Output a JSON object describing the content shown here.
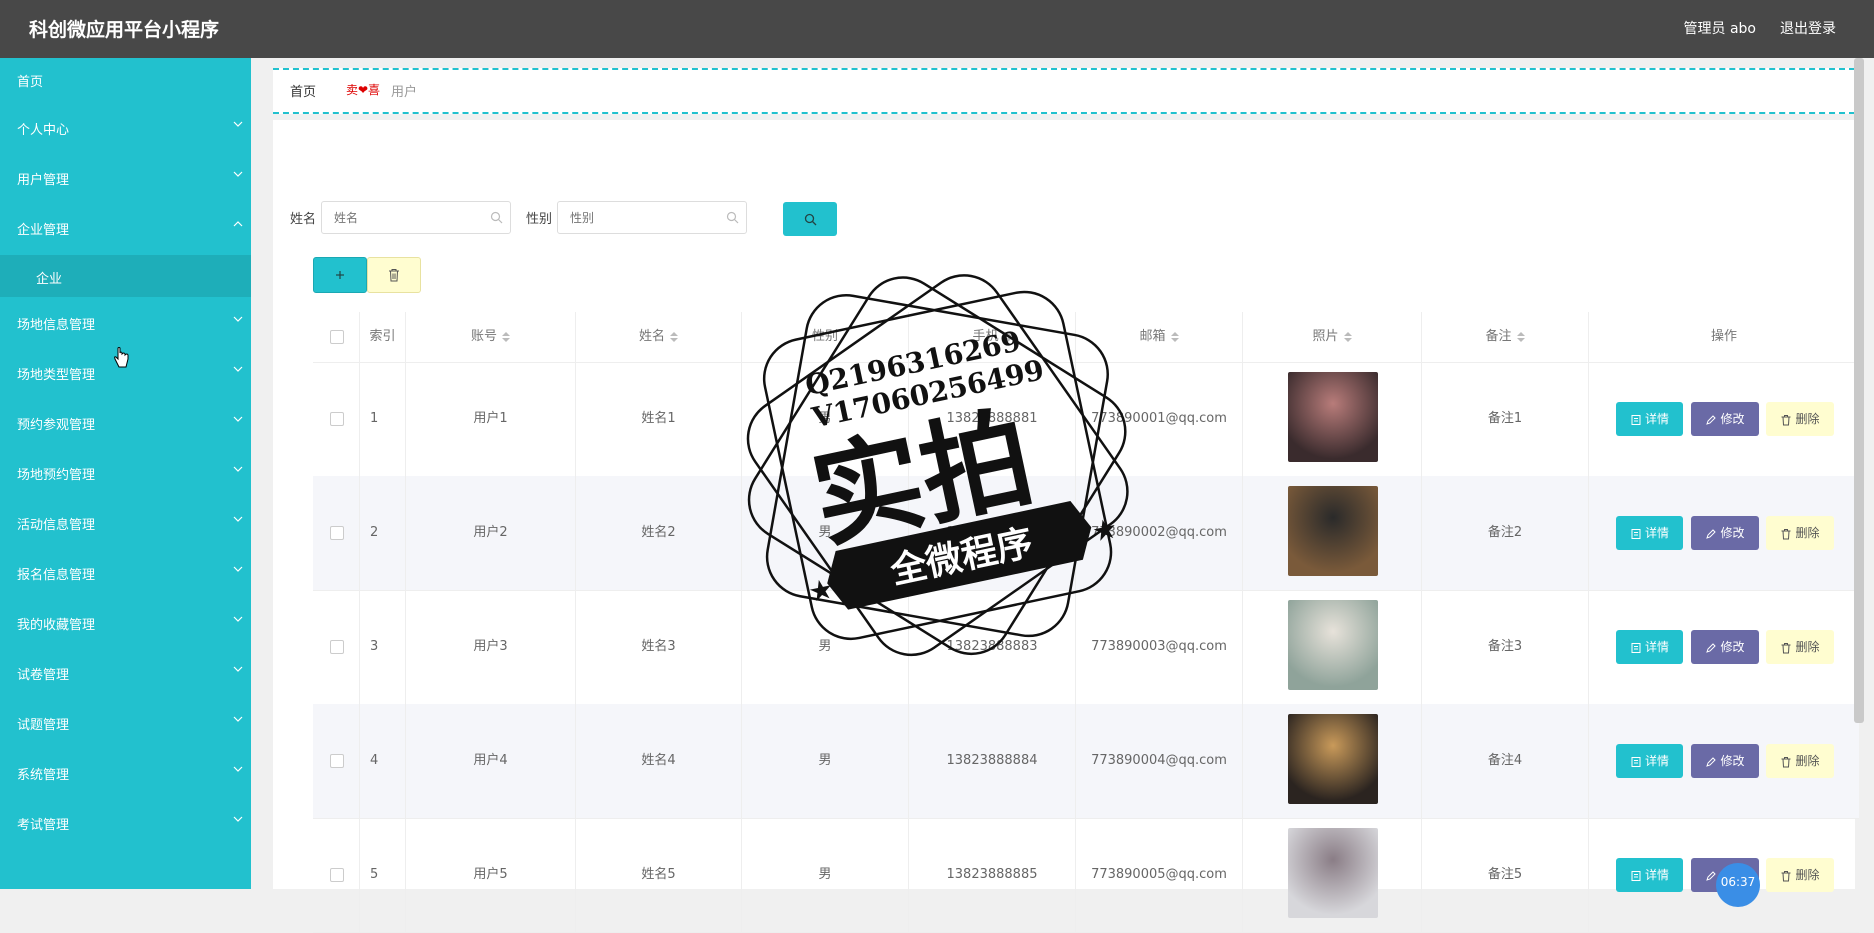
{
  "header": {
    "title": "科创微应用平台小程序",
    "admin": "管理员 abo",
    "logout": "退出登录"
  },
  "sidebar": {
    "items": [
      {
        "label": "首页",
        "chevron": ""
      },
      {
        "label": "个人中心",
        "chevron": "down"
      },
      {
        "label": "用户管理",
        "chevron": "down"
      },
      {
        "label": "企业管理",
        "chevron": "up"
      },
      {
        "label": "企业",
        "chevron": "",
        "sub": true
      },
      {
        "label": "场地信息管理",
        "chevron": "down"
      },
      {
        "label": "场地类型管理",
        "chevron": "down"
      },
      {
        "label": "预约参观管理",
        "chevron": "down"
      },
      {
        "label": "场地预约管理",
        "chevron": "down"
      },
      {
        "label": "活动信息管理",
        "chevron": "down"
      },
      {
        "label": "报名信息管理",
        "chevron": "down"
      },
      {
        "label": "我的收藏管理",
        "chevron": "down"
      },
      {
        "label": "试卷管理",
        "chevron": "down"
      },
      {
        "label": "试题管理",
        "chevron": "down"
      },
      {
        "label": "系统管理",
        "chevron": "down"
      },
      {
        "label": "考试管理",
        "chevron": "down"
      }
    ]
  },
  "breadcrumb": {
    "home": "首页",
    "separator": "卖❤喜",
    "current": "用户"
  },
  "search": {
    "name_label": "姓名",
    "name_placeholder": "姓名",
    "gender_label": "性别",
    "gender_placeholder": "性别"
  },
  "table": {
    "columns": [
      "索引",
      "账号",
      "姓名",
      "性别",
      "手机",
      "邮箱",
      "照片",
      "备注",
      "操作"
    ],
    "rows": [
      {
        "index": "1",
        "account": "用户1",
        "name": "姓名1",
        "gender": "男",
        "phone": "13823888881",
        "email": "773890001@qq.com",
        "remark": "备注1"
      },
      {
        "index": "2",
        "account": "用户2",
        "name": "姓名2",
        "gender": "男",
        "phone": "13823888882",
        "email": "773890002@qq.com",
        "remark": "备注2"
      },
      {
        "index": "3",
        "account": "用户3",
        "name": "姓名3",
        "gender": "男",
        "phone": "13823888883",
        "email": "773890003@qq.com",
        "remark": "备注3"
      },
      {
        "index": "4",
        "account": "用户4",
        "name": "姓名4",
        "gender": "男",
        "phone": "13823888884",
        "email": "773890004@qq.com",
        "remark": "备注4"
      },
      {
        "index": "5",
        "account": "用户5",
        "name": "姓名5",
        "gender": "男",
        "phone": "13823888885",
        "email": "773890005@qq.com",
        "remark": "备注5"
      }
    ],
    "actions": {
      "detail": "详情",
      "edit": "修改",
      "delete": "删除"
    }
  },
  "watermark": {
    "line1": "Q2196316269",
    "line2": "V17060256499",
    "main": "实拍",
    "banner": "全微程序"
  },
  "clock": "06:37",
  "colors": {
    "accent": "#22c1ce",
    "header": "#484848",
    "edit": "#6a6aa6",
    "delete_bg": "#fffdd0"
  }
}
